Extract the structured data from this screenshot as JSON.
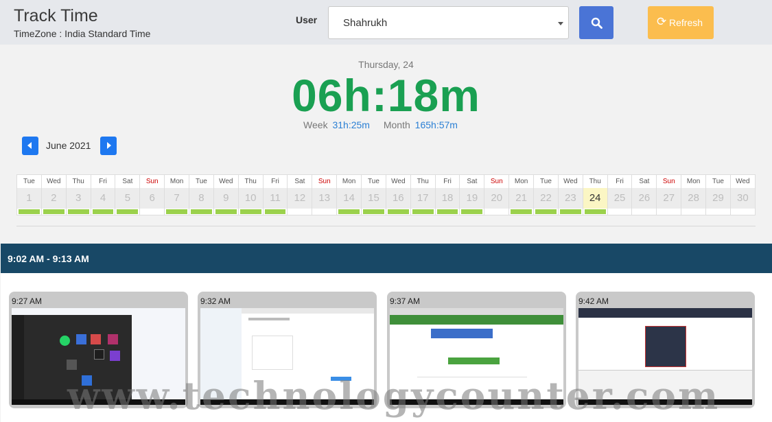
{
  "header": {
    "title": "Track Time",
    "timezone": "TimeZone : India Standard Time",
    "user_label": "User",
    "user_value": "Shahrukh",
    "search_icon": "search-icon",
    "refresh_label": "Refresh",
    "refresh_icon": "refresh-icon",
    "colors": {
      "search": "#4a74d6",
      "refresh": "#fbbd4e"
    }
  },
  "summary": {
    "date": "Thursday, 24",
    "total": "06h:18m",
    "week_label": "Week",
    "week_value": "31h:25m",
    "month_label": "Month",
    "month_value": "165h:57m",
    "colors": {
      "total": "#1aa052",
      "links": "#2a7fd4"
    }
  },
  "calendar": {
    "month": "June 2021",
    "days": [
      {
        "dow": "Tue",
        "num": "1",
        "tracked": true
      },
      {
        "dow": "Wed",
        "num": "2",
        "tracked": true
      },
      {
        "dow": "Thu",
        "num": "3",
        "tracked": true
      },
      {
        "dow": "Fri",
        "num": "4",
        "tracked": true
      },
      {
        "dow": "Sat",
        "num": "5",
        "tracked": true
      },
      {
        "dow": "Sun",
        "num": "6",
        "tracked": false
      },
      {
        "dow": "Mon",
        "num": "7",
        "tracked": true
      },
      {
        "dow": "Tue",
        "num": "8",
        "tracked": true
      },
      {
        "dow": "Wed",
        "num": "9",
        "tracked": true
      },
      {
        "dow": "Thu",
        "num": "10",
        "tracked": true
      },
      {
        "dow": "Fri",
        "num": "11",
        "tracked": true
      },
      {
        "dow": "Sat",
        "num": "12",
        "tracked": false
      },
      {
        "dow": "Sun",
        "num": "13",
        "tracked": false
      },
      {
        "dow": "Mon",
        "num": "14",
        "tracked": true
      },
      {
        "dow": "Tue",
        "num": "15",
        "tracked": true
      },
      {
        "dow": "Wed",
        "num": "16",
        "tracked": true
      },
      {
        "dow": "Thu",
        "num": "17",
        "tracked": true
      },
      {
        "dow": "Fri",
        "num": "18",
        "tracked": true
      },
      {
        "dow": "Sat",
        "num": "19",
        "tracked": true
      },
      {
        "dow": "Sun",
        "num": "20",
        "tracked": false
      },
      {
        "dow": "Mon",
        "num": "21",
        "tracked": true
      },
      {
        "dow": "Tue",
        "num": "22",
        "tracked": true
      },
      {
        "dow": "Wed",
        "num": "23",
        "tracked": true
      },
      {
        "dow": "Thu",
        "num": "24",
        "tracked": true,
        "today": true
      },
      {
        "dow": "Fri",
        "num": "25",
        "tracked": false
      },
      {
        "dow": "Sat",
        "num": "26",
        "tracked": false
      },
      {
        "dow": "Sun",
        "num": "27",
        "tracked": false
      },
      {
        "dow": "Mon",
        "num": "28",
        "tracked": false
      },
      {
        "dow": "Tue",
        "num": "29",
        "tracked": false
      },
      {
        "dow": "Wed",
        "num": "30",
        "tracked": false
      }
    ],
    "colors": {
      "tracked": "#9bd14c",
      "today": "#fbf6c4",
      "sunday": "#cc0000"
    }
  },
  "session": {
    "range": "9:02 AM - 9:13 AM",
    "color": "#184866"
  },
  "screenshots": [
    {
      "time": "9:27 AM"
    },
    {
      "time": "9:32 AM"
    },
    {
      "time": "9:37 AM"
    },
    {
      "time": "9:42 AM"
    }
  ],
  "watermark": "www.technologycounter.com"
}
